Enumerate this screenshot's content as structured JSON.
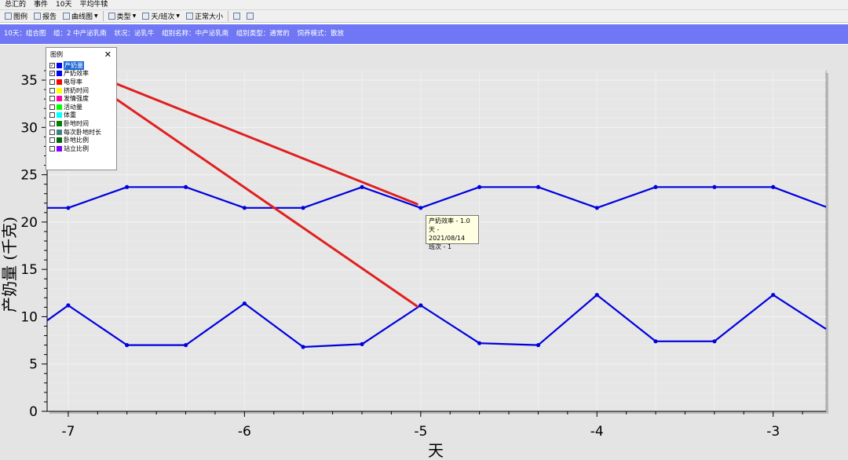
{
  "menu": [
    "总汇的",
    "事件",
    "10天",
    "平均牛犊"
  ],
  "toolbar": {
    "legend": "图例",
    "report": "报告",
    "curve": "曲线图",
    "type": "类型",
    "day_shift": "天/班次",
    "normal_size": "正常大小"
  },
  "infobar": [
    "10天：组合图",
    "组：2 中产泌乳南",
    "状况：泌乳牛",
    "组别名称：中产泌乳南",
    "组别类型：通常的",
    "饲养模式：散放"
  ],
  "legend": {
    "title": "图例",
    "close": "✕",
    "items": [
      {
        "label": "产奶量",
        "color": "#0000ee",
        "checked": true,
        "selected": true
      },
      {
        "label": "产奶效率",
        "color": "#0000ee",
        "checked": true,
        "selected": false
      },
      {
        "label": "电导率",
        "color": "#ff0000",
        "checked": false,
        "selected": false
      },
      {
        "label": "挤奶时间",
        "color": "#ffff00",
        "checked": false,
        "selected": false
      },
      {
        "label": "发情强度",
        "color": "#ff00aa",
        "checked": false,
        "selected": false
      },
      {
        "label": "活动量",
        "color": "#00ff00",
        "checked": false,
        "selected": false
      },
      {
        "label": "体重",
        "color": "#00ffff",
        "checked": false,
        "selected": false
      },
      {
        "label": "卧地时间",
        "color": "#008000",
        "checked": false,
        "selected": false
      },
      {
        "label": "每次卧地时长",
        "color": "#408080",
        "checked": false,
        "selected": false
      },
      {
        "label": "卧地比例",
        "color": "#006400",
        "checked": false,
        "selected": false
      },
      {
        "label": "站立比例",
        "color": "#8000ff",
        "checked": false,
        "selected": false
      }
    ]
  },
  "tooltip": [
    "产奶效率 - 1.0",
    "天 - 2021/08/14",
    "班次 - 1"
  ],
  "chart_data": {
    "type": "line",
    "ylabel": "产奶量 (千克)",
    "xlabel": "天",
    "xlim": [
      -7.12,
      -2.7
    ],
    "ylim": [
      0,
      36
    ],
    "xticks": [
      -7,
      -6,
      -5,
      -4,
      -3
    ],
    "yticks": [
      0,
      5,
      10,
      15,
      20,
      25,
      30,
      35
    ],
    "grid": true,
    "series": [
      {
        "name": "产奶量",
        "color": "#0000dd",
        "x": [
          -7.12,
          -7,
          -6.667,
          -6.333,
          -6,
          -5.667,
          -5.333,
          -5,
          -4.667,
          -4.333,
          -4,
          -3.667,
          -3.333,
          -3,
          -2.7
        ],
        "y": [
          21.5,
          21.5,
          23.7,
          23.7,
          21.5,
          21.5,
          23.7,
          21.5,
          23.7,
          23.7,
          21.5,
          23.7,
          23.7,
          23.7,
          21.6
        ],
        "markers": [
          false,
          true,
          true,
          true,
          true,
          true,
          true,
          true,
          true,
          true,
          true,
          true,
          true,
          true,
          false
        ]
      },
      {
        "name": "产奶效率",
        "color": "#0000dd",
        "x": [
          -7.12,
          -7,
          -6.667,
          -6.333,
          -6,
          -5.667,
          -5.333,
          -5,
          -4.667,
          -4.333,
          -4,
          -3.667,
          -3.333,
          -3,
          -2.7
        ],
        "y": [
          9.6,
          11.2,
          7.0,
          7.0,
          11.4,
          6.8,
          7.1,
          11.2,
          7.2,
          7.0,
          12.3,
          7.4,
          7.4,
          12.3,
          8.7
        ],
        "markers": [
          false,
          true,
          true,
          true,
          true,
          true,
          true,
          true,
          true,
          true,
          true,
          true,
          true,
          true,
          false
        ]
      }
    ],
    "annotations": [
      {
        "type": "arrow",
        "color": "#e02020",
        "from": [
          -6.9,
          35.9
        ],
        "to": [
          -5.02,
          21.9
        ]
      },
      {
        "type": "arrow",
        "color": "#e02020",
        "from": [
          -6.9,
          35.2
        ],
        "to": [
          -5.02,
          11.1
        ]
      }
    ]
  }
}
